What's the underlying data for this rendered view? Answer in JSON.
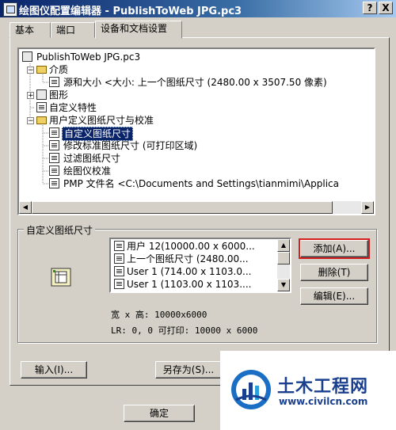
{
  "window": {
    "title": "绘图仪配置编辑器 - PublishToWeb JPG.pc3",
    "help_label": "?",
    "close_label": "X"
  },
  "tabs": [
    {
      "label": "基本"
    },
    {
      "label": "端口"
    },
    {
      "label": "设备和文档设置"
    }
  ],
  "tree": {
    "root": "PublishToWeb JPG.pc3",
    "media": "介质",
    "source_size": "源和大小 <大小: 上一个图纸尺寸  (2480.00 x 3507.50 像素)",
    "graphics": "图形",
    "custom_props": "自定义特性",
    "user_sizes": "用户定义图纸尺寸与校准",
    "custom_sizes": "自定义图纸尺寸",
    "modify_sizes": "修改标准图纸尺寸 (可打印区域)",
    "filter_sizes": "过滤图纸尺寸",
    "calibration": "绘图仪校准",
    "pmp_file": "PMP 文件名 <C:\\Documents and Settings\\tianmimi\\Applica"
  },
  "group": {
    "label": "自定义图纸尺寸",
    "items": [
      "用户 12(10000.00 x 6000...",
      "上一个图纸尺寸  (2480.00...",
      "User 1 (714.00 x 1103.0...",
      "User 1 (1103.00 x 1103...."
    ],
    "add_label": "添加(A)...",
    "delete_label": "删除(T)",
    "edit_label": "编辑(E)...",
    "size_info": "宽 x 高: 10000x6000",
    "printable_info": "LR: 0, 0  可打印: 10000 x 6000"
  },
  "bottom": {
    "import_label": "输入(I)...",
    "saveas_label": "另存为(S)...",
    "ok_label": "确定"
  },
  "watermark": {
    "name": "土木工程网",
    "url": "www.civilcn.com"
  }
}
